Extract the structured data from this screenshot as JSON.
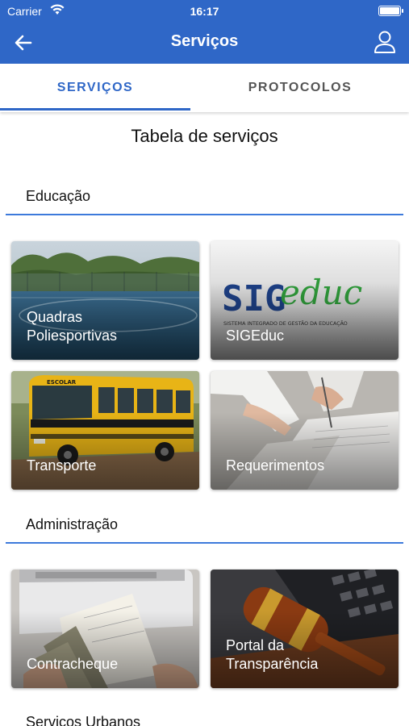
{
  "status_bar": {
    "carrier": "Carrier",
    "time": "16:17"
  },
  "app_bar": {
    "title": "Serviços",
    "back_icon": "arrow-left-icon",
    "profile_icon": "user-icon"
  },
  "tabs": [
    {
      "label": "SERVIÇOS",
      "active": true
    },
    {
      "label": "PROTOCOLOS",
      "active": false
    }
  ],
  "page_heading": "Tabela de serviços",
  "sections": [
    {
      "title": "Educação",
      "cards": [
        {
          "label": "Quadras\nPoliesportivas"
        },
        {
          "label": "SIGEduc",
          "logo_text_sig": "SIG",
          "logo_text_educ": "educ",
          "logo_subtitle": "SISTEMA INTEGRADO DE GESTÃO DA EDUCAÇÃO"
        },
        {
          "label": "Transporte",
          "bus_sign": "ESCOLAR"
        },
        {
          "label": "Requerimentos"
        }
      ]
    },
    {
      "title": "Administração",
      "cards": [
        {
          "label": "Contracheque"
        },
        {
          "label": "Portal da\nTransparência"
        }
      ]
    },
    {
      "title": "Serviços Urbanos"
    }
  ],
  "colors": {
    "primary": "#2f67c7",
    "divider": "#3d7adb"
  }
}
